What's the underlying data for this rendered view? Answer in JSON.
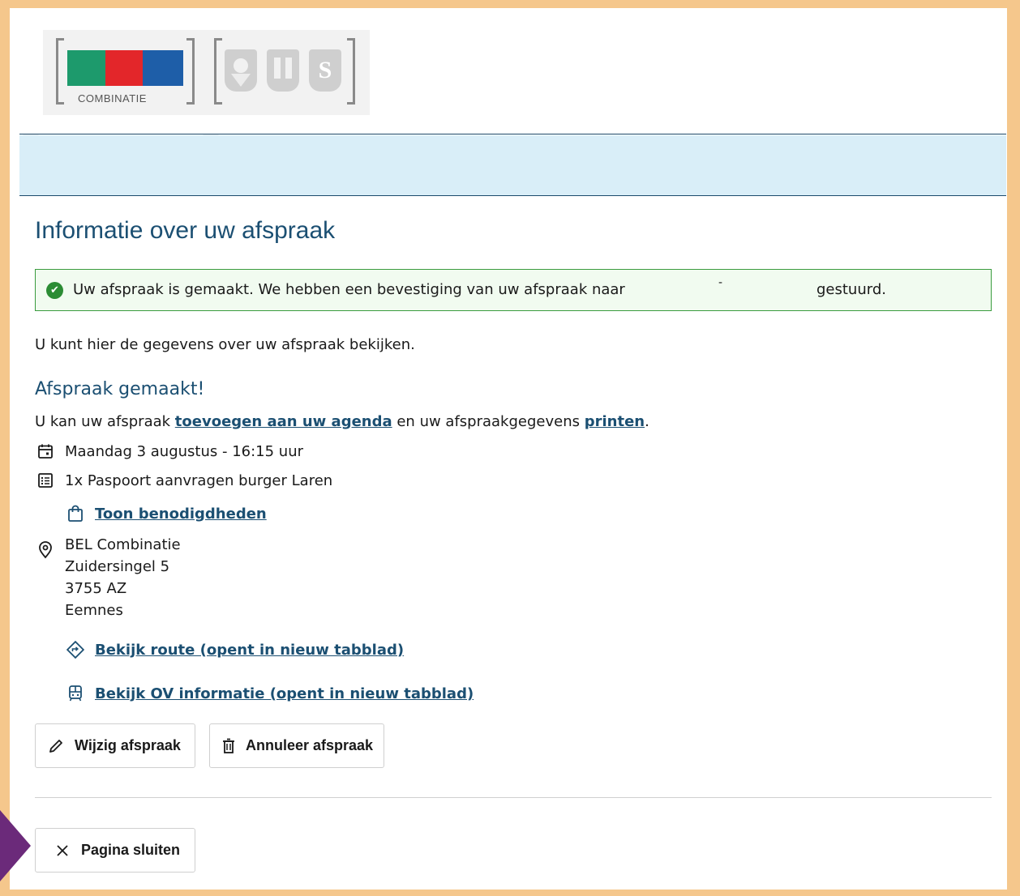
{
  "logo": {
    "combinatie_text": "COMBINATIE",
    "bel_colors": [
      "#1d9a6c",
      "#e3262a",
      "#1e5ea8"
    ],
    "crest_s": "S"
  },
  "page": {
    "title": "Informatie over uw afspraak",
    "alert": {
      "icon": "check-circle-icon",
      "text": "Uw afspraak is gemaakt. We hebben een bevestiging van uw afspraak naar",
      "redaction_dash": "-",
      "text_end": "gestuurd.",
      "color": "#3a9b3e"
    },
    "intro": "U kunt hier de gegevens over uw afspraak bekijken.",
    "subtitle": "Afspraak gemaakt!",
    "sentence": {
      "part1": "U kan uw afspraak ",
      "link_agenda": "toevoegen aan uw agenda",
      "part2": " en uw afspraakgegevens ",
      "link_print": "printen",
      "part3": "."
    },
    "date": "Maandag 3 augustus - 16:15 uur",
    "product": "1x Paspoort aanvragen burger Laren",
    "show_needs_link": "Toon benodigdheden",
    "address": {
      "name": "BEL Combinatie",
      "street": "Zuidersingel 5",
      "postcode": "3755 AZ",
      "city": "Eemnes"
    },
    "route_link": "Bekijk route (opent in nieuw tabblad)",
    "ov_link": "Bekijk OV informatie (opent in nieuw tabblad)",
    "edit_button": "Wijzig afspraak",
    "cancel_button": "Annuleer afspraak",
    "close_button": "Pagina sluiten"
  },
  "colors": {
    "heading": "#1b4f72",
    "band": "#d9eef8",
    "frame": "#f5c78c",
    "pointer": "#6b2a7a"
  }
}
